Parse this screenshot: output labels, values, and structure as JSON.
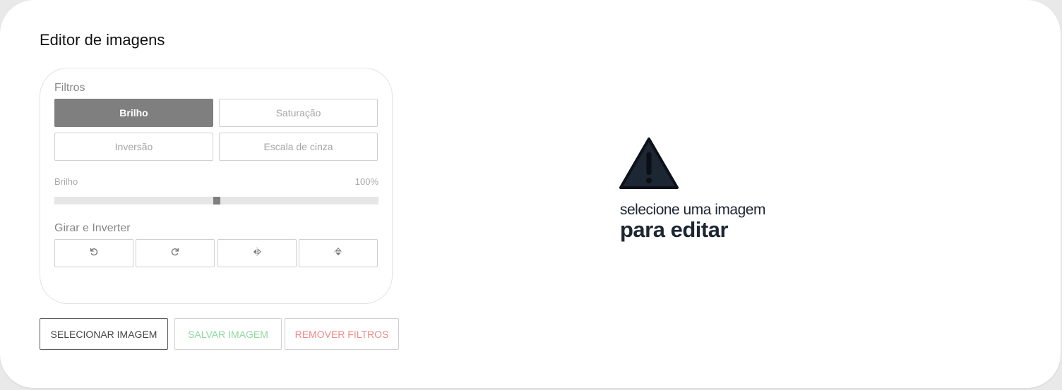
{
  "page": {
    "title": "Editor de imagens"
  },
  "filters": {
    "section_label": "Filtros",
    "options": [
      "Brilho",
      "Saturação",
      "Inversão",
      "Escala de cinza"
    ],
    "active": "Brilho"
  },
  "slider": {
    "label": "Brilho",
    "value_label": "100%",
    "value_fraction": 0.5
  },
  "rotate": {
    "section_label": "Girar e Inverter",
    "buttons": [
      {
        "icon": "rotate-left-icon"
      },
      {
        "icon": "rotate-right-icon"
      },
      {
        "icon": "flip-horizontal-icon"
      },
      {
        "icon": "flip-vertical-icon"
      }
    ]
  },
  "actions": {
    "select_label": "SELECIONAR IMAGEM",
    "save_label": "SALVAR IMAGEM",
    "remove_label": "REMOVER FILTROS"
  },
  "preview": {
    "icon": "warning-icon",
    "line1": "selecione uma imagem",
    "line2": "para editar"
  },
  "colors": {
    "active_filter": "#7f7f7f",
    "save": "#8fd99c",
    "remove": "#f08a8a",
    "text_dark": "#1d2633"
  }
}
